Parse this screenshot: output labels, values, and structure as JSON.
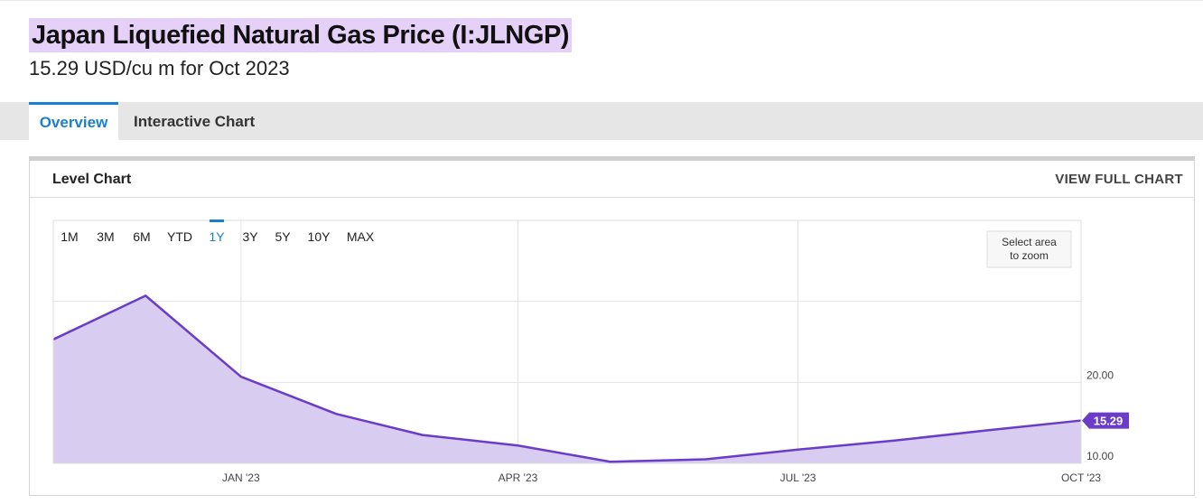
{
  "header": {
    "title": "Japan Liquefied Natural Gas Price (I:JLNGP)",
    "subtitle": "15.29 USD/cu m for Oct 2023"
  },
  "tabs": [
    {
      "label": "Overview",
      "active": true
    },
    {
      "label": "Interactive Chart",
      "active": false
    }
  ],
  "card": {
    "title": "Level Chart",
    "view_full_label": "VIEW FULL CHART"
  },
  "range_buttons": [
    {
      "label": "1M",
      "active": false
    },
    {
      "label": "3M",
      "active": false
    },
    {
      "label": "6M",
      "active": false
    },
    {
      "label": "YTD",
      "active": false
    },
    {
      "label": "1Y",
      "active": true
    },
    {
      "label": "3Y",
      "active": false
    },
    {
      "label": "5Y",
      "active": false
    },
    {
      "label": "10Y",
      "active": false
    },
    {
      "label": "MAX",
      "active": false
    }
  ],
  "zoom_hint": [
    "Select area",
    "to zoom"
  ],
  "colors": {
    "accent": "#1a7fd0",
    "line": "#6a3cc8",
    "fill": "#d8ccf0",
    "highlight": "#e5d0f7"
  },
  "chart_data": {
    "type": "area",
    "x": [
      "2022-11-01",
      "2022-12-01",
      "2023-01-01",
      "2023-02-01",
      "2023-03-01",
      "2023-04-01",
      "2023-05-01",
      "2023-06-01",
      "2023-07-01",
      "2023-08-01",
      "2023-09-01",
      "2023-10-01"
    ],
    "series": [
      {
        "values": [
          25.3,
          30.7,
          20.7,
          16.1,
          13.5,
          12.2,
          10.2,
          10.5,
          11.7,
          12.8,
          14.1,
          15.29
        ]
      }
    ],
    "x_ticks": [
      {
        "label": "JAN '23",
        "at": "2023-01-01"
      },
      {
        "label": "APR '23",
        "at": "2023-04-01"
      },
      {
        "label": "JUL '23",
        "at": "2023-07-01"
      },
      {
        "label": "OCT '23",
        "at": "2023-10-01"
      }
    ],
    "x_range": [
      "2022-11-01",
      "2023-10-01"
    ],
    "y_ticks": [
      {
        "label": "20.00",
        "value": 20
      },
      {
        "label": "10.00",
        "value": 10
      }
    ],
    "y_gridlines": [
      10,
      20,
      30
    ],
    "ylim": [
      10,
      40
    ],
    "last_value_label": "15.29",
    "grid": true,
    "legend": "none"
  }
}
